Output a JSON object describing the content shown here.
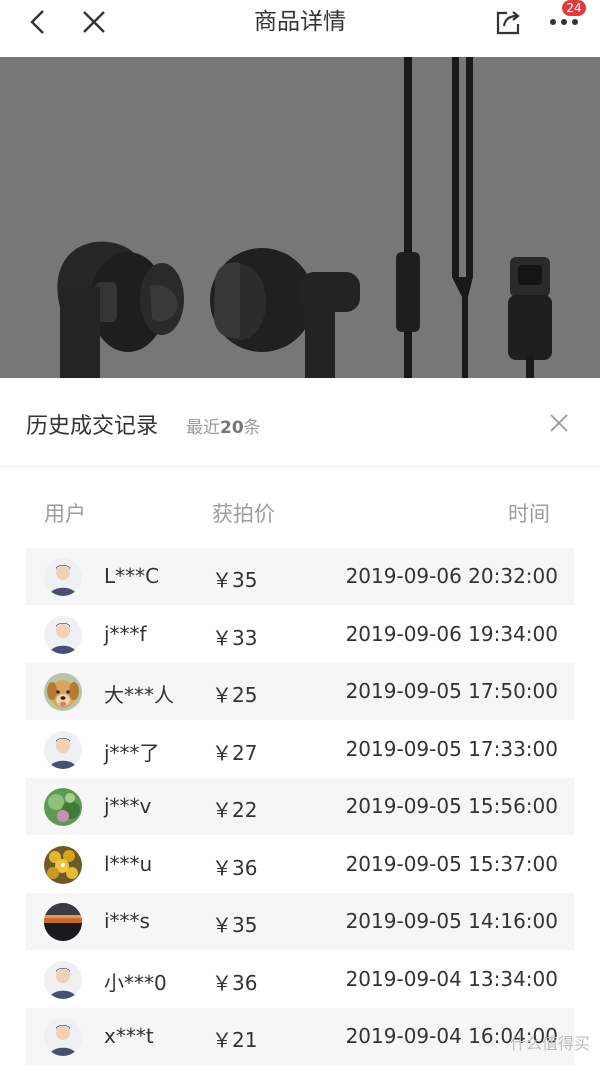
{
  "header": {
    "title": "商品详情",
    "badge_count": "24"
  },
  "history": {
    "title": "历史成交记录",
    "subtitle_prefix": "最近",
    "subtitle_count": "20",
    "subtitle_suffix": "条",
    "columns": {
      "user": "用户",
      "price": "获拍价",
      "time": "时间"
    },
    "rows": [
      {
        "user": "L***C",
        "price": "￥35",
        "time": "2019-09-06 20:32:00",
        "avatar": "default-avatar"
      },
      {
        "user": "j***f",
        "price": "￥33",
        "time": "2019-09-06 19:34:00",
        "avatar": "default-avatar"
      },
      {
        "user": "大***人",
        "price": "￥25",
        "time": "2019-09-05 17:50:00",
        "avatar": "dog-avatar"
      },
      {
        "user": "j***了",
        "price": "￥27",
        "time": "2019-09-05 17:33:00",
        "avatar": "default-avatar"
      },
      {
        "user": "j***v",
        "price": "￥22",
        "time": "2019-09-05 15:56:00",
        "avatar": "green-photo-avatar"
      },
      {
        "user": "l***u",
        "price": "￥36",
        "time": "2019-09-05 15:37:00",
        "avatar": "fruit-photo-avatar"
      },
      {
        "user": "i***s",
        "price": "￥35",
        "time": "2019-09-05 14:16:00",
        "avatar": "sunset-photo-avatar"
      },
      {
        "user": "小***0",
        "price": "￥36",
        "time": "2019-09-04 13:34:00",
        "avatar": "default-avatar"
      },
      {
        "user": "x***t",
        "price": "￥21",
        "time": "2019-09-04 16:04:00",
        "avatar": "default-avatar"
      }
    ]
  },
  "watermark": "什么值得买",
  "colors": {
    "badge": "#e23b3b",
    "hero_bg": "#777777",
    "row_alt": "#f6f6f6"
  }
}
